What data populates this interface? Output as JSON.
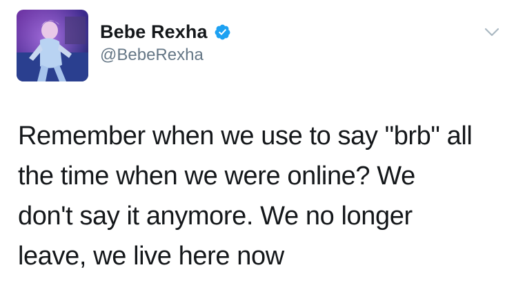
{
  "author": {
    "display_name": "Bebe Rexha",
    "handle": "@BebeRexha",
    "verified": true
  },
  "tweet": {
    "lines": [
      "Remember when we use to say \"brb\" all",
      "the time when we were online? We",
      "don't say it anymore. We no longer",
      "leave, we live here now"
    ]
  },
  "icons": {
    "verified": "verified-badge-icon",
    "menu": "chevron-down-icon",
    "avatar": "profile-photo"
  },
  "colors": {
    "verified_blue": "#1da1f2",
    "text": "#14171a",
    "secondary_text": "#657786",
    "chevron": "#aab8c2"
  }
}
